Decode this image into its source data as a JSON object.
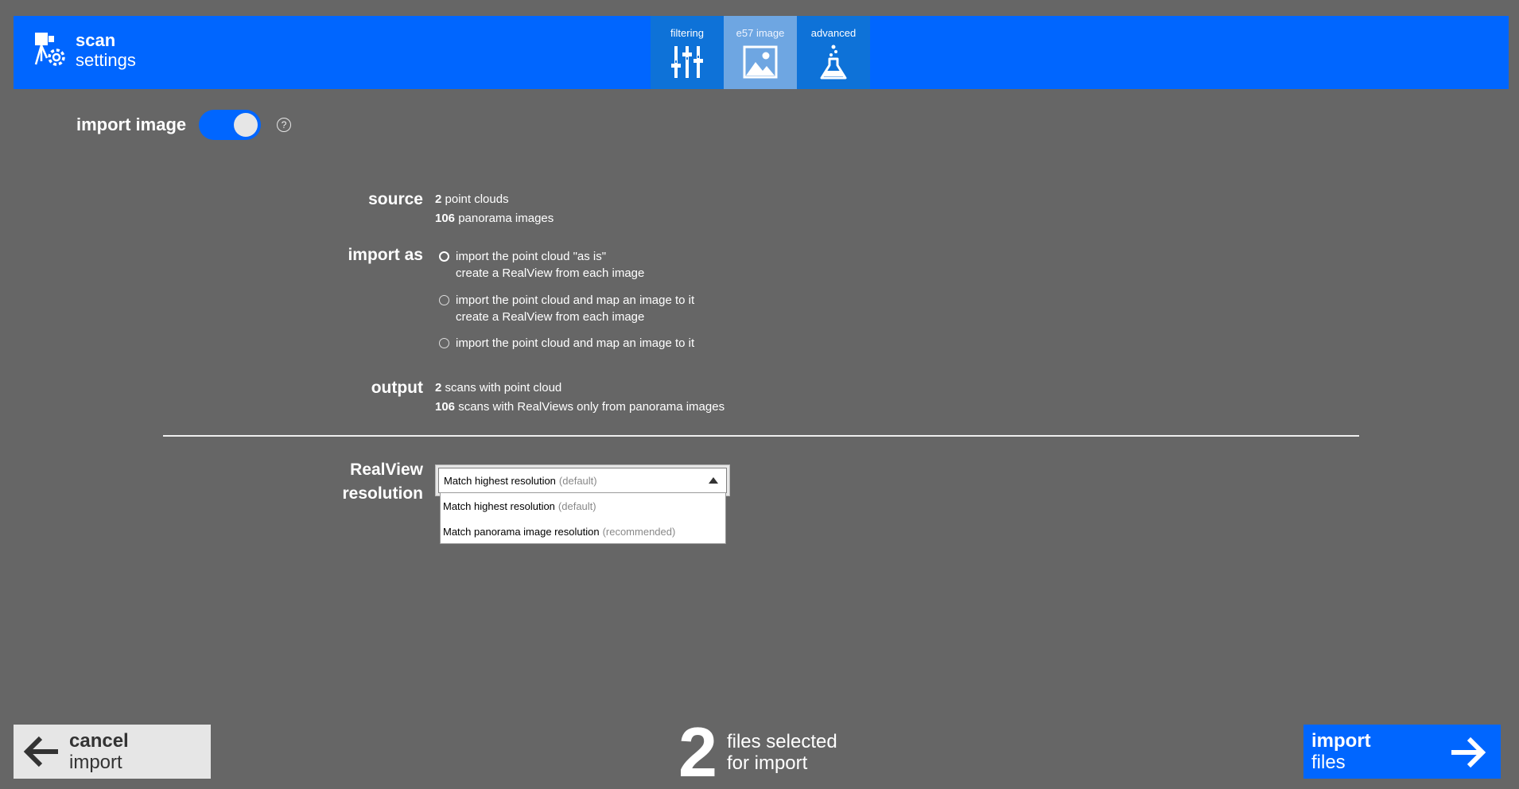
{
  "header": {
    "title_line1": "scan",
    "title_line2": "settings",
    "tabs": [
      {
        "label": "filtering",
        "icon": "sliders-icon"
      },
      {
        "label": "e57 image",
        "icon": "image-icon",
        "active": true
      },
      {
        "label": "advanced",
        "icon": "flask-icon"
      }
    ]
  },
  "import_image": {
    "label": "import image",
    "enabled": true,
    "help": "?"
  },
  "source": {
    "label": "source",
    "line1_count": "2",
    "line1_text": " point clouds",
    "line2_count": "106",
    "line2_text": " panorama images"
  },
  "import_as": {
    "label": "import as",
    "options": [
      {
        "line1": "import the point cloud \"as is\"",
        "line2": "create a RealView from each image",
        "selected": true
      },
      {
        "line1": "import the point cloud and map an image to it",
        "line2": "create a RealView from each image",
        "selected": false
      },
      {
        "line1": "import the point cloud and map an image to it",
        "line2": "",
        "selected": false
      }
    ]
  },
  "output": {
    "label": "output",
    "line1_count": "2",
    "line1_text": " scans with point cloud",
    "line2_count": "106",
    "line2_text": " scans with RealViews only from panorama images"
  },
  "realview": {
    "label_line1": "RealView",
    "label_line2": "resolution",
    "selected_main": "Match highest resolution",
    "selected_note": "(default)",
    "options": [
      {
        "main": "Match highest resolution",
        "note": "(default)"
      },
      {
        "main": "Match panorama image resolution",
        "note": "(recommended)"
      }
    ]
  },
  "footer": {
    "cancel_line1": "cancel",
    "cancel_line2": "import",
    "count": "2",
    "count_line1": "files selected",
    "count_line2": "for import",
    "import_line1": "import",
    "import_line2": "files"
  },
  "colors": {
    "background": "#666666",
    "accent": "#0066ff",
    "active_tab": "#6ea6e2"
  }
}
